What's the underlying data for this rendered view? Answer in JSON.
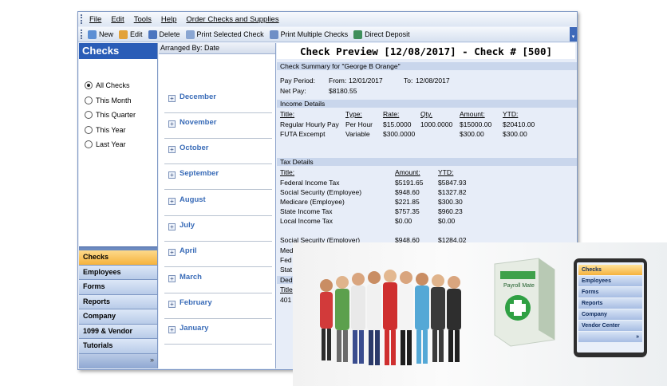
{
  "menu": [
    "File",
    "Edit",
    "Tools",
    "Help",
    "Order Checks and Supplies"
  ],
  "toolbar": [
    {
      "label": "New",
      "icon": "new-icon",
      "color": "#5d8fd4"
    },
    {
      "label": "Edit",
      "icon": "edit-icon",
      "color": "#e2a23a"
    },
    {
      "label": "Delete",
      "icon": "delete-icon",
      "color": "#4b75bf"
    },
    {
      "label": "Print Selected Check",
      "icon": "print-icon",
      "color": "#8aa6d2"
    },
    {
      "label": "Print Multiple Checks",
      "icon": "print-multiple-icon",
      "color": "#6f8fc6"
    },
    {
      "label": "Direct Deposit",
      "icon": "deposit-icon",
      "color": "#3f8f5b"
    }
  ],
  "left": {
    "title": "Checks",
    "filters": [
      {
        "label": "All Checks",
        "selected": true
      },
      {
        "label": "This Month",
        "selected": false
      },
      {
        "label": "This Quarter",
        "selected": false
      },
      {
        "label": "This Year",
        "selected": false
      },
      {
        "label": "Last Year",
        "selected": false
      }
    ],
    "nav": [
      "Checks",
      "Employees",
      "Forms",
      "Reports",
      "Company",
      "1099 & Vendor",
      "Tutorials"
    ],
    "active_nav": "Checks"
  },
  "months": {
    "header": "Arranged By: Date",
    "items": [
      "December",
      "November",
      "October",
      "September",
      "August",
      "July",
      "April",
      "March",
      "February",
      "January"
    ]
  },
  "preview": {
    "title": "Check Preview [12/08/2017] - Check # [500]",
    "summary_label": "Check Summary for \"George B Orange\"",
    "pay_period_label": "Pay Period:",
    "from_label": "From:",
    "from_date": "12/01/2017",
    "to_label": "To:",
    "to_date": "12/08/2017",
    "net_pay_label": "Net Pay:",
    "net_pay": "$8180.55",
    "income_header": "Income Details",
    "income_columns": [
      "Title:",
      "Type:",
      "Rate:",
      "Qty.",
      "Amount:",
      "YTD:"
    ],
    "income_rows": [
      [
        "Regular Hourly Pay",
        "Per Hour",
        "$15.0000",
        "1000.0000",
        "$15000.00",
        "$20410.00"
      ],
      [
        "FUTA Excempt",
        "Variable",
        "$300.0000",
        "",
        "$300.00",
        "$300.00"
      ]
    ],
    "tax_header": "Tax Details",
    "tax_columns": [
      "Title:",
      "Amount:",
      "YTD:"
    ],
    "tax_rows": [
      [
        "Federal Income Tax",
        "$5191.65",
        "$5847.93"
      ],
      [
        "Social Security (Employee)",
        "$948.60",
        "$1327.82"
      ],
      [
        "Medicare (Employee)",
        "$221.85",
        "$300.30"
      ],
      [
        "State Income Tax",
        "$757.35",
        "$960.23"
      ],
      [
        "Local Income Tax",
        "$0.00",
        "$0.00"
      ]
    ],
    "employer_rows": [
      [
        "Social Security (Employer)",
        "$948.60",
        "$1284.02"
      ],
      [
        "Med",
        "",
        ""
      ],
      [
        "Fed",
        "",
        ""
      ],
      [
        "Stat",
        "",
        ""
      ]
    ],
    "deductions_header": "Ded",
    "deductions_title": "Title",
    "deductions_first": "401"
  },
  "promo": {
    "box_label": "Payroll Mate",
    "phone_nav": [
      "Checks",
      "Employees",
      "Forms",
      "Reports",
      "Company",
      "Vendor Center"
    ]
  }
}
